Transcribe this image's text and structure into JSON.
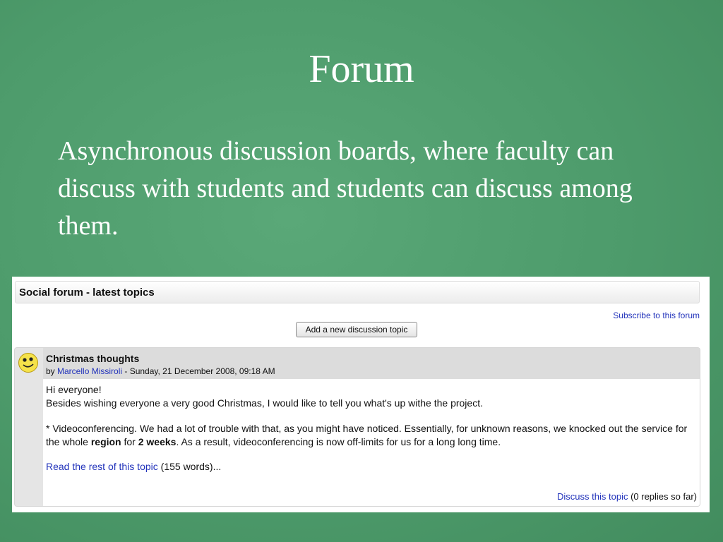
{
  "slide": {
    "title": "Forum",
    "body": "Asynchronous discussion boards, where faculty can discuss with students and students can discuss among them."
  },
  "forum": {
    "header": "Social forum - latest topics",
    "subscribe_label": "Subscribe to this forum",
    "add_topic_label": "Add a new discussion topic"
  },
  "post": {
    "avatar_icon": "smiley-face-icon",
    "title": "Christmas thoughts",
    "by_prefix": "by ",
    "author": "Marcello Missiroli",
    "date": " - Sunday, 21 December 2008, 09:18 AM",
    "line1": "Hi everyone!",
    "line2": "Besides wishing everyone a very good Christmas, I would like to tell you what's up withe the project.",
    "para2_a": "* Videoconferencing. We had a lot of trouble with that, as you might have noticed. Essentially, for unknown reasons, we knocked out the service for the whole ",
    "para2_bold1": "region",
    "para2_b": " for ",
    "para2_bold2": "2 weeks",
    "para2_c": ". As a result, videoconferencing is now off-limits for us for a long long time.",
    "read_more_label": "Read the rest of this topic",
    "word_count": " (155 words)...",
    "discuss_label": "Discuss this topic",
    "replies": " (0 replies so far)"
  }
}
